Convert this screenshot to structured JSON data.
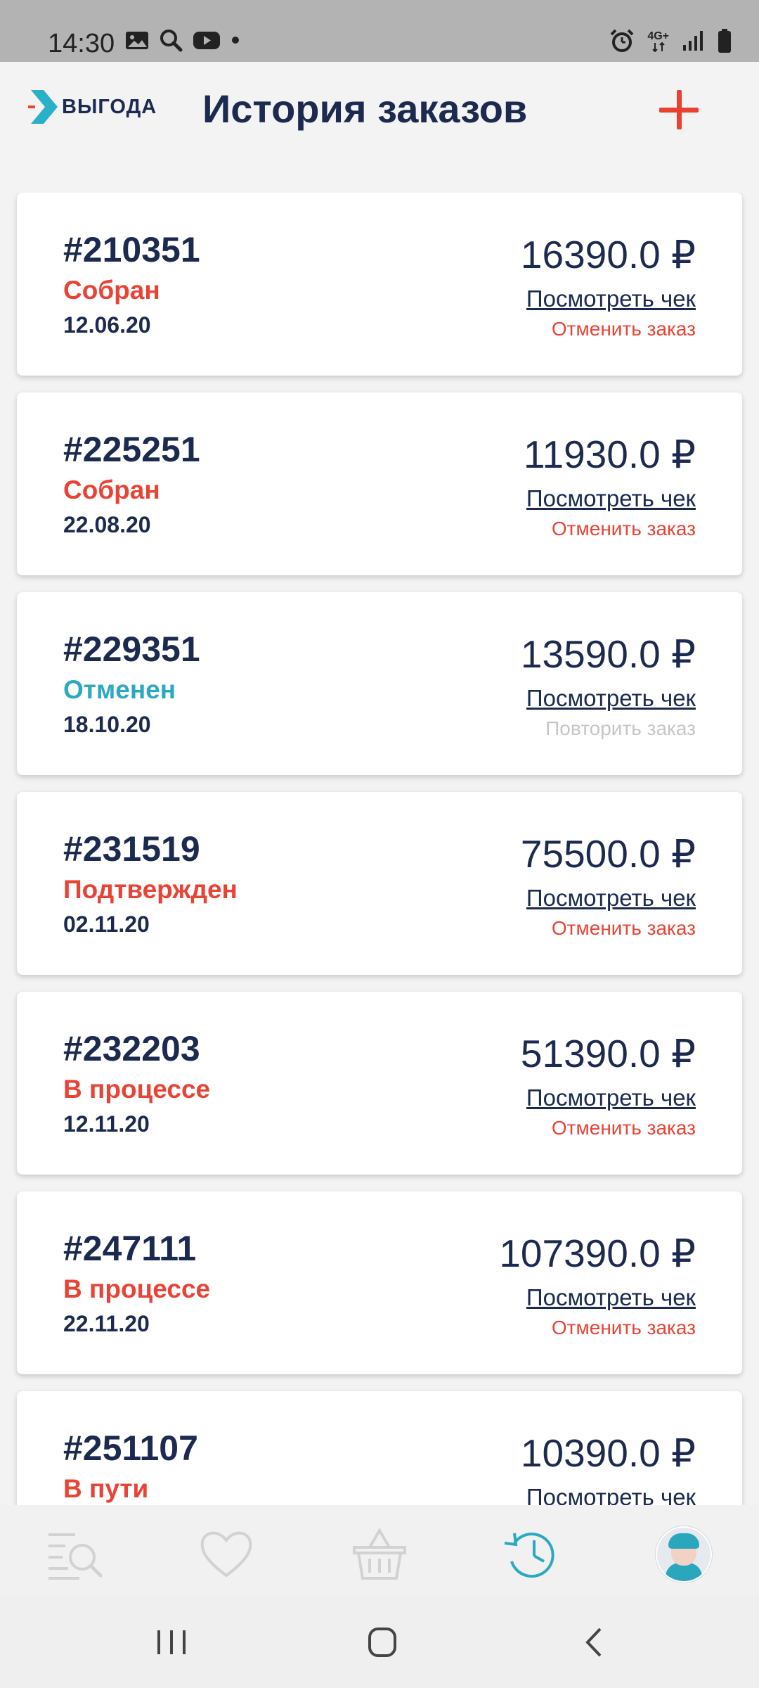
{
  "status_bar": {
    "time": "14:30",
    "left_icons": [
      "image-icon",
      "search-icon",
      "youtube-icon",
      "dot-icon"
    ],
    "right_icons": [
      "alarm-icon",
      "4g-icon",
      "signal-icon",
      "battery-icon"
    ],
    "network": "4G+"
  },
  "header": {
    "logo_text": "ВЫГОДА",
    "title": "История заказов",
    "add_icon": "plus-icon",
    "accent_color": "#ea4031"
  },
  "orders": [
    {
      "number": "#210351",
      "status": "Собран",
      "date": "12.06.20",
      "price": "16390.0 ₽",
      "view_label": "Посмотреть чек",
      "action_label": "Отменить заказ",
      "status_kind": "active"
    },
    {
      "number": "#225251",
      "status": "Собран",
      "date": "22.08.20",
      "price": "11930.0 ₽",
      "view_label": "Посмотреть чек",
      "action_label": "Отменить заказ",
      "status_kind": "active"
    },
    {
      "number": "#229351",
      "status": "Отменен",
      "date": "18.10.20",
      "price": "13590.0 ₽",
      "view_label": "Посмотреть чек",
      "action_label": "Повторить заказ",
      "status_kind": "canceled"
    },
    {
      "number": "#231519",
      "status": "Подтвержден",
      "date": "02.11.20",
      "price": "75500.0 ₽",
      "view_label": "Посмотреть чек",
      "action_label": "Отменить заказ",
      "status_kind": "active"
    },
    {
      "number": "#232203",
      "status": "В процессе",
      "date": "12.11.20",
      "price": "51390.0 ₽",
      "view_label": "Посмотреть чек",
      "action_label": "Отменить заказ",
      "status_kind": "active"
    },
    {
      "number": "#247111",
      "status": "В процессе",
      "date": "22.11.20",
      "price": "107390.0 ₽",
      "view_label": "Посмотреть чек",
      "action_label": "Отменить заказ",
      "status_kind": "active"
    },
    {
      "number": "#251107",
      "status": "В пути",
      "date": "",
      "price": "10390.0 ₽",
      "view_label": "Посмотреть чек",
      "action_label": "",
      "status_kind": "active"
    }
  ],
  "bottom_nav": {
    "items": [
      "catalog-search-icon",
      "favorites-heart-icon",
      "basket-icon",
      "history-icon",
      "profile-avatar"
    ],
    "active": "history-icon",
    "active_color": "#2ba9c2"
  },
  "system_nav": {
    "items": [
      "recent-apps-icon",
      "home-icon",
      "back-icon"
    ]
  }
}
